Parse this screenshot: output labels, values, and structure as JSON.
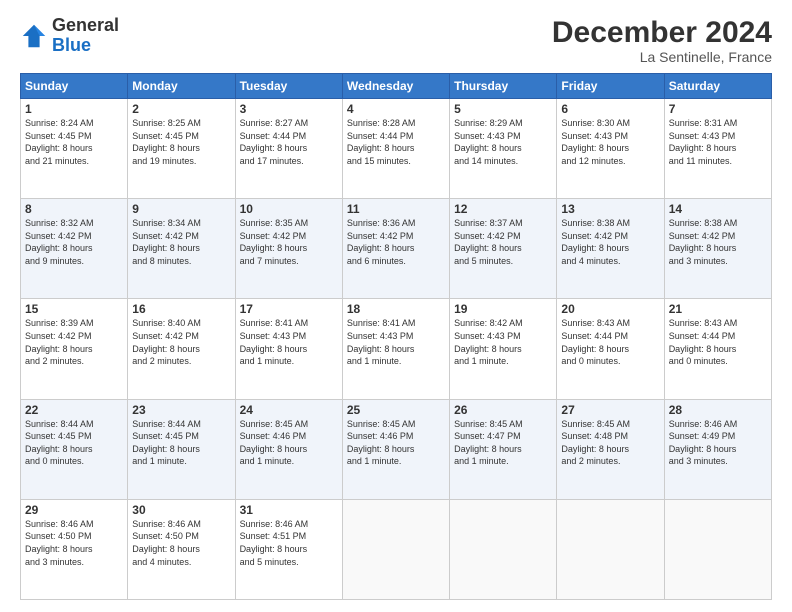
{
  "header": {
    "logo_general": "General",
    "logo_blue": "Blue",
    "month_title": "December 2024",
    "subtitle": "La Sentinelle, France"
  },
  "days_of_week": [
    "Sunday",
    "Monday",
    "Tuesday",
    "Wednesday",
    "Thursday",
    "Friday",
    "Saturday"
  ],
  "weeks": [
    [
      {
        "day": "1",
        "info": "Sunrise: 8:24 AM\nSunset: 4:45 PM\nDaylight: 8 hours\nand 21 minutes."
      },
      {
        "day": "2",
        "info": "Sunrise: 8:25 AM\nSunset: 4:45 PM\nDaylight: 8 hours\nand 19 minutes."
      },
      {
        "day": "3",
        "info": "Sunrise: 8:27 AM\nSunset: 4:44 PM\nDaylight: 8 hours\nand 17 minutes."
      },
      {
        "day": "4",
        "info": "Sunrise: 8:28 AM\nSunset: 4:44 PM\nDaylight: 8 hours\nand 15 minutes."
      },
      {
        "day": "5",
        "info": "Sunrise: 8:29 AM\nSunset: 4:43 PM\nDaylight: 8 hours\nand 14 minutes."
      },
      {
        "day": "6",
        "info": "Sunrise: 8:30 AM\nSunset: 4:43 PM\nDaylight: 8 hours\nand 12 minutes."
      },
      {
        "day": "7",
        "info": "Sunrise: 8:31 AM\nSunset: 4:43 PM\nDaylight: 8 hours\nand 11 minutes."
      }
    ],
    [
      {
        "day": "8",
        "info": "Sunrise: 8:32 AM\nSunset: 4:42 PM\nDaylight: 8 hours\nand 9 minutes."
      },
      {
        "day": "9",
        "info": "Sunrise: 8:34 AM\nSunset: 4:42 PM\nDaylight: 8 hours\nand 8 minutes."
      },
      {
        "day": "10",
        "info": "Sunrise: 8:35 AM\nSunset: 4:42 PM\nDaylight: 8 hours\nand 7 minutes."
      },
      {
        "day": "11",
        "info": "Sunrise: 8:36 AM\nSunset: 4:42 PM\nDaylight: 8 hours\nand 6 minutes."
      },
      {
        "day": "12",
        "info": "Sunrise: 8:37 AM\nSunset: 4:42 PM\nDaylight: 8 hours\nand 5 minutes."
      },
      {
        "day": "13",
        "info": "Sunrise: 8:38 AM\nSunset: 4:42 PM\nDaylight: 8 hours\nand 4 minutes."
      },
      {
        "day": "14",
        "info": "Sunrise: 8:38 AM\nSunset: 4:42 PM\nDaylight: 8 hours\nand 3 minutes."
      }
    ],
    [
      {
        "day": "15",
        "info": "Sunrise: 8:39 AM\nSunset: 4:42 PM\nDaylight: 8 hours\nand 2 minutes."
      },
      {
        "day": "16",
        "info": "Sunrise: 8:40 AM\nSunset: 4:42 PM\nDaylight: 8 hours\nand 2 minutes."
      },
      {
        "day": "17",
        "info": "Sunrise: 8:41 AM\nSunset: 4:43 PM\nDaylight: 8 hours\nand 1 minute."
      },
      {
        "day": "18",
        "info": "Sunrise: 8:41 AM\nSunset: 4:43 PM\nDaylight: 8 hours\nand 1 minute."
      },
      {
        "day": "19",
        "info": "Sunrise: 8:42 AM\nSunset: 4:43 PM\nDaylight: 8 hours\nand 1 minute."
      },
      {
        "day": "20",
        "info": "Sunrise: 8:43 AM\nSunset: 4:44 PM\nDaylight: 8 hours\nand 0 minutes."
      },
      {
        "day": "21",
        "info": "Sunrise: 8:43 AM\nSunset: 4:44 PM\nDaylight: 8 hours\nand 0 minutes."
      }
    ],
    [
      {
        "day": "22",
        "info": "Sunrise: 8:44 AM\nSunset: 4:45 PM\nDaylight: 8 hours\nand 0 minutes."
      },
      {
        "day": "23",
        "info": "Sunrise: 8:44 AM\nSunset: 4:45 PM\nDaylight: 8 hours\nand 1 minute."
      },
      {
        "day": "24",
        "info": "Sunrise: 8:45 AM\nSunset: 4:46 PM\nDaylight: 8 hours\nand 1 minute."
      },
      {
        "day": "25",
        "info": "Sunrise: 8:45 AM\nSunset: 4:46 PM\nDaylight: 8 hours\nand 1 minute."
      },
      {
        "day": "26",
        "info": "Sunrise: 8:45 AM\nSunset: 4:47 PM\nDaylight: 8 hours\nand 1 minute."
      },
      {
        "day": "27",
        "info": "Sunrise: 8:45 AM\nSunset: 4:48 PM\nDaylight: 8 hours\nand 2 minutes."
      },
      {
        "day": "28",
        "info": "Sunrise: 8:46 AM\nSunset: 4:49 PM\nDaylight: 8 hours\nand 3 minutes."
      }
    ],
    [
      {
        "day": "29",
        "info": "Sunrise: 8:46 AM\nSunset: 4:50 PM\nDaylight: 8 hours\nand 3 minutes."
      },
      {
        "day": "30",
        "info": "Sunrise: 8:46 AM\nSunset: 4:50 PM\nDaylight: 8 hours\nand 4 minutes."
      },
      {
        "day": "31",
        "info": "Sunrise: 8:46 AM\nSunset: 4:51 PM\nDaylight: 8 hours\nand 5 minutes."
      },
      null,
      null,
      null,
      null
    ]
  ]
}
